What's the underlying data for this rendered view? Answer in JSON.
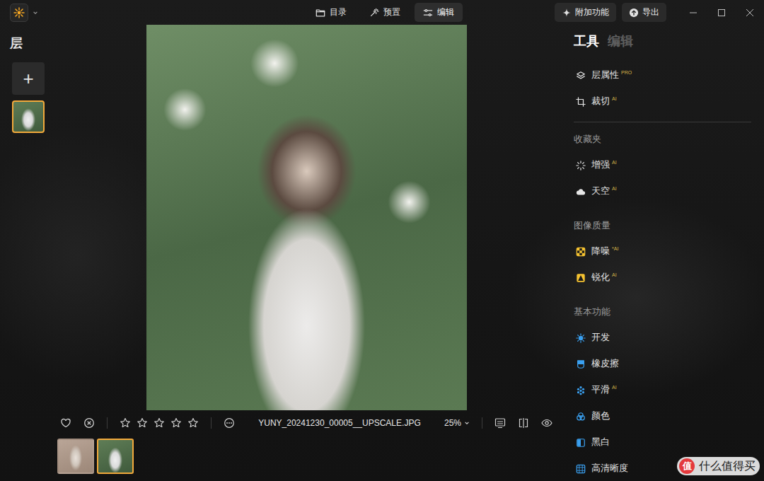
{
  "titlebar": {
    "tabs": [
      {
        "label": "目录",
        "selected": false
      },
      {
        "label": "预置",
        "selected": false
      },
      {
        "label": "编辑",
        "selected": true
      }
    ],
    "actions": [
      "附加功能",
      "导出"
    ]
  },
  "layers_panel": {
    "title": "层",
    "add_label": "+",
    "layers": [
      {
        "selected": true
      }
    ]
  },
  "photo": {
    "liked": false,
    "rejected": false,
    "stars": 0,
    "filename": "YUNY_20241230_00005__UPSCALE.JPG",
    "zoom": "25%"
  },
  "filmstrip": [
    {
      "selected": false
    },
    {
      "selected": true
    }
  ],
  "tool_panel": {
    "tabs": [
      {
        "label": "工具",
        "selected": true
      },
      {
        "label": "编辑",
        "selected": false
      }
    ],
    "pinned": [
      {
        "label": "层属性",
        "badge": "PRO"
      },
      {
        "label": "裁切",
        "badge": "AI"
      }
    ],
    "sections": [
      {
        "title": "收藏夹",
        "items": [
          {
            "label": "增强",
            "badge": "AI"
          },
          {
            "label": "天空",
            "badge": "AI"
          }
        ]
      },
      {
        "title": "图像质量",
        "items": [
          {
            "label": "降噪",
            "badge": "*AI"
          },
          {
            "label": "锐化",
            "badge": "AI"
          }
        ]
      },
      {
        "title": "基本功能",
        "items": [
          {
            "label": "开发"
          },
          {
            "label": "橡皮擦"
          },
          {
            "label": "平滑",
            "badge": "AI"
          },
          {
            "label": "颜色"
          },
          {
            "label": "黑白"
          },
          {
            "label": "高清晰度"
          }
        ]
      }
    ]
  },
  "watermark": {
    "logo": "值",
    "text": "什么值得买"
  }
}
